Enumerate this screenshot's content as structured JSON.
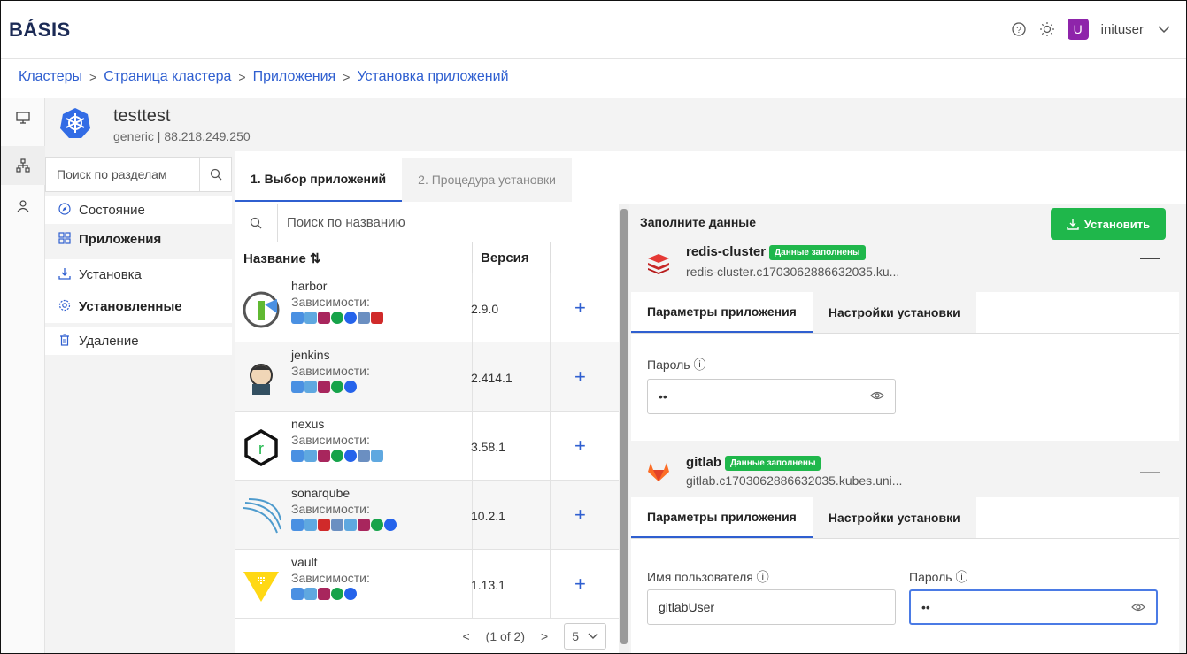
{
  "header": {
    "logo": "BÁSIS",
    "help_icon": "help-circle-icon",
    "theme_icon": "sun-icon",
    "avatar_letter": "U",
    "username": "inituser"
  },
  "breadcrumb": [
    "Кластеры",
    "Страница кластера",
    "Приложения",
    "Установка приложений"
  ],
  "cluster": {
    "name": "testtest",
    "subtitle": "generic | 88.218.249.250"
  },
  "sections": {
    "search_placeholder": "Поиск по разделам",
    "items": [
      "Состояние",
      "Приложения",
      "Установка",
      "Установленные",
      "Удаление"
    ]
  },
  "steps": [
    "1. Выбор приложений",
    "2. Процедура установки"
  ],
  "applist": {
    "search_placeholder": "Поиск по названию",
    "columns": [
      "Название",
      "Версия"
    ],
    "deps_label": "Зависимости:",
    "rows": [
      {
        "name": "harbor",
        "version": "2.9.0"
      },
      {
        "name": "jenkins",
        "version": "2.414.1"
      },
      {
        "name": "nexus",
        "version": "3.58.1"
      },
      {
        "name": "sonarqube",
        "version": "10.2.1"
      },
      {
        "name": "vault",
        "version": "1.13.1"
      }
    ],
    "pager": {
      "label": "(1 of 2)",
      "page_size": "5"
    }
  },
  "right": {
    "title": "Заполните данные",
    "install_label": "Установить",
    "badge": "Данные заполнены",
    "tab_params": "Параметры приложения",
    "tab_settings": "Настройки установки",
    "redis": {
      "name": "redis-cluster",
      "host": "redis-cluster.c1703062886632035.ku...",
      "password_label": "Пароль",
      "password_value": "••"
    },
    "gitlab": {
      "name": "gitlab",
      "host": "gitlab.c1703062886632035.kubes.uni...",
      "user_label": "Имя пользователя",
      "user_value": "gitlabUser",
      "password_label": "Пароль",
      "password_value": "••"
    }
  },
  "colors": {
    "accent": "#2f5fd0",
    "success": "#1fb74b",
    "avatar": "#8e24aa"
  }
}
